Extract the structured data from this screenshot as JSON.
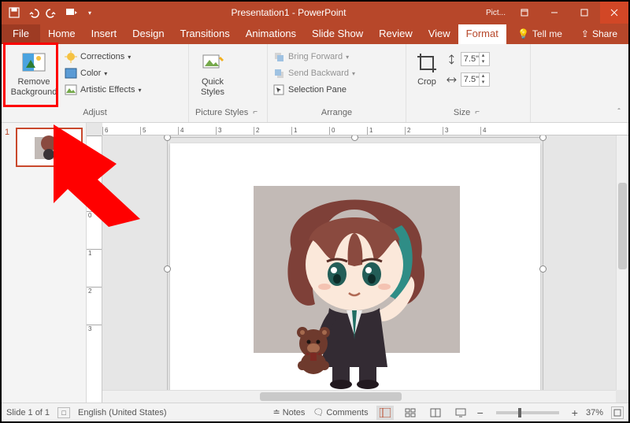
{
  "titlebar": {
    "doc_title": "Presentation1 - PowerPoint",
    "pict_tools": "Pict..."
  },
  "tabs": {
    "file": "File",
    "home": "Home",
    "insert": "Insert",
    "design": "Design",
    "transitions": "Transitions",
    "animations": "Animations",
    "slideshow": "Slide Show",
    "review": "Review",
    "view": "View",
    "format": "Format",
    "tellme": "Tell me",
    "share": "Share"
  },
  "ribbon": {
    "remove_bg": "Remove Background",
    "corrections": "Corrections",
    "color": "Color",
    "artistic": "Artistic Effects",
    "adjust_label": "Adjust",
    "quick_styles": "Quick Styles",
    "picture_styles_label": "Picture Styles",
    "bring_forward": "Bring Forward",
    "send_backward": "Send Backward",
    "selection_pane": "Selection Pane",
    "arrange_label": "Arrange",
    "crop": "Crop",
    "size_h": "7.5\"",
    "size_w": "7.5\"",
    "size_label": "Size"
  },
  "ruler_h": [
    "6",
    "5",
    "4",
    "3",
    "2",
    "1",
    "0",
    "1",
    "2",
    "3",
    "4"
  ],
  "ruler_v": [
    "",
    "1",
    "0",
    "1",
    "2",
    "3"
  ],
  "slide_panel": {
    "num": "1"
  },
  "status": {
    "slide": "Slide 1 of 1",
    "lang": "English (United States)",
    "notes": "Notes",
    "comments": "Comments",
    "zoom": "37%"
  }
}
